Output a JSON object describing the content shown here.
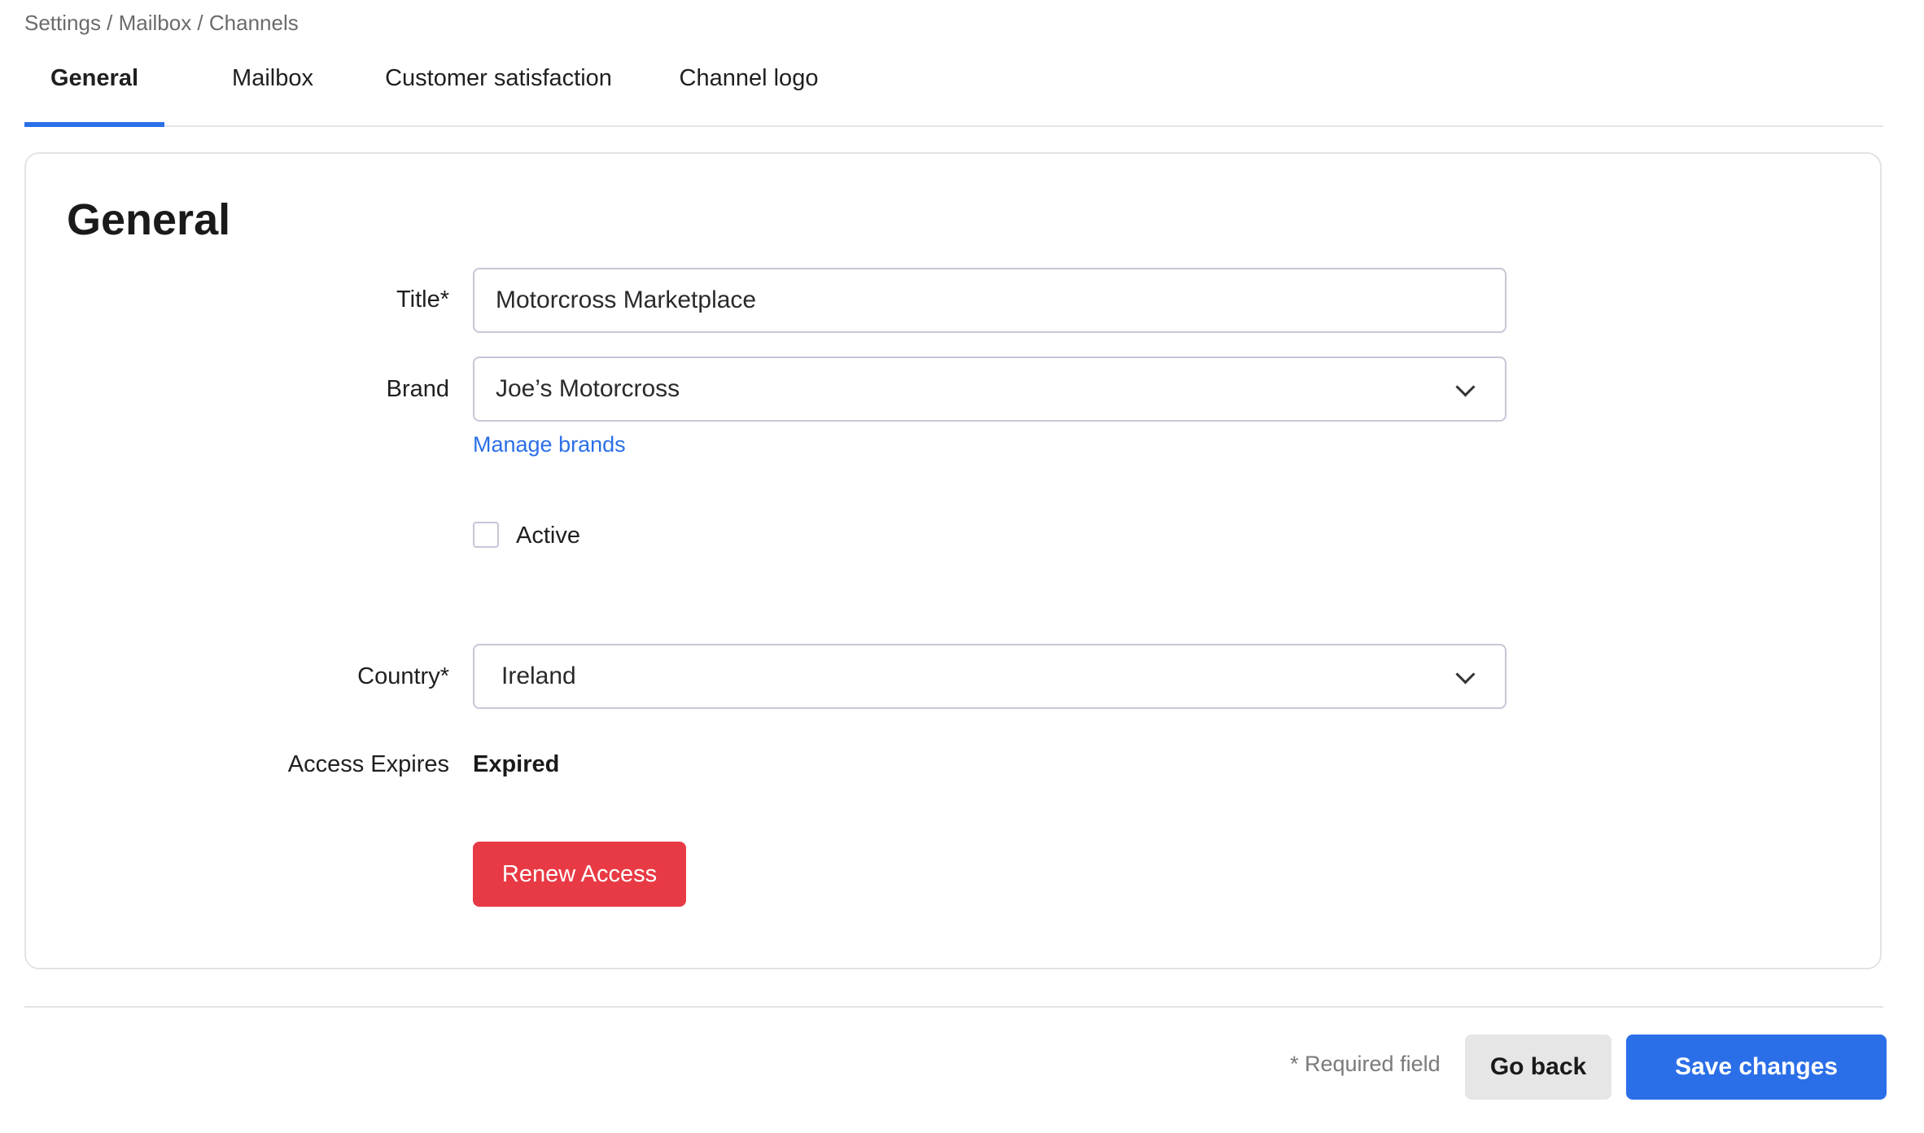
{
  "breadcrumb": "Settings / Mailbox / Channels",
  "tabs": [
    {
      "label": "General",
      "active": true
    },
    {
      "label": "Mailbox",
      "active": false
    },
    {
      "label": "Customer satisfaction",
      "active": false
    },
    {
      "label": "Channel logo",
      "active": false
    }
  ],
  "card": {
    "title": "General"
  },
  "form": {
    "title_label": "Title*",
    "title_value": "Motorcross Marketplace",
    "brand_label": "Brand",
    "brand_value": "Joe’s Motorcross",
    "manage_brands_link": "Manage brands",
    "active_label": "Active",
    "active_checked": false,
    "country_label": "Country*",
    "country_value": "Ireland",
    "access_expires_label": "Access Expires",
    "access_expires_value": "Expired",
    "renew_button": "Renew Access"
  },
  "footer": {
    "required_note": "* Required field",
    "go_back_button": "Go back",
    "save_button": "Save changes"
  },
  "colors": {
    "accent": "#2b6fe8",
    "danger": "#e83a45"
  }
}
